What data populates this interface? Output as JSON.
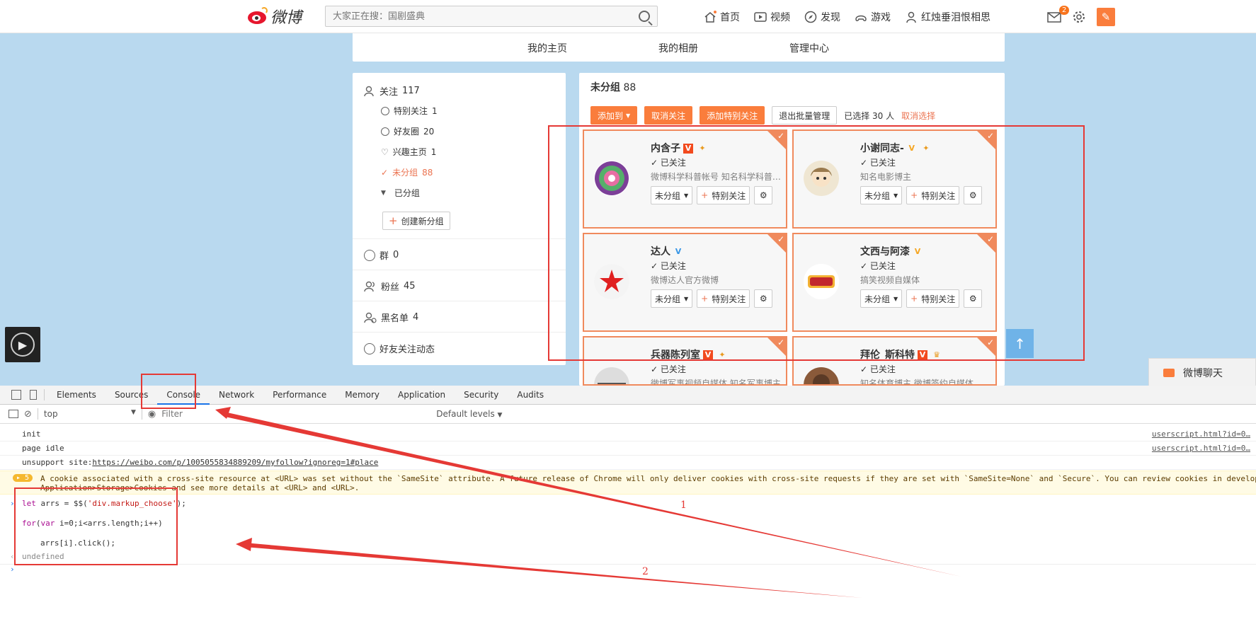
{
  "topbar": {
    "logo_text": "微博",
    "search_placeholder": "大家正在搜：国剧盛典",
    "nav": [
      "首页",
      "视频",
      "发现",
      "游戏",
      "红烛垂泪恨相思"
    ],
    "message_badge": "2"
  },
  "subnav": [
    "我的主页",
    "我的相册",
    "管理中心"
  ],
  "left": {
    "follow": "关注",
    "follow_count": "117",
    "sub": [
      {
        "label": "特别关注",
        "count": "1"
      },
      {
        "label": "好友圈",
        "count": "20"
      },
      {
        "label": "兴趣主页",
        "count": "1"
      },
      {
        "label": "未分组",
        "count": "88"
      },
      {
        "label": "已分组",
        "count": ""
      }
    ],
    "create_group": "创建新分组",
    "groups": {
      "label": "群",
      "count": "0"
    },
    "fans": {
      "label": "粉丝",
      "count": "45"
    },
    "blacklist": {
      "label": "黑名单",
      "count": "4"
    },
    "friend_feed": "好友关注动态"
  },
  "right": {
    "title": "未分组",
    "title_count": "88",
    "actions": {
      "add_to": "添加到",
      "unfollow": "取消关注",
      "add_special": "添加特别关注",
      "exit_batch": "退出批量管理",
      "selected": "已选择 30 人",
      "cancel_select": "取消选择"
    },
    "followed_label": "已关注",
    "group_btn": "未分组",
    "special_btn": "特别关注",
    "cards": [
      {
        "name": "内含子",
        "desc": "微博科学科普帐号 知名科学科普…"
      },
      {
        "name": "小谢同志-",
        "desc": "知名电影博主"
      },
      {
        "name": "达人",
        "desc": "微博达人官方微博"
      },
      {
        "name": "文西与阿漆",
        "desc": "搞笑视频自媒体"
      },
      {
        "name": "兵器陈列室",
        "desc": "微博军事视频自媒体 知名军事博主"
      },
      {
        "name": "拜伦_斯科特",
        "desc": "知名体育博主 微博签约自媒体"
      }
    ]
  },
  "chat": "微博聊天",
  "devtools": {
    "tabs": [
      "Elements",
      "Sources",
      "Console",
      "Network",
      "Performance",
      "Memory",
      "Application",
      "Security",
      "Audits"
    ],
    "context": "top",
    "filter_placeholder": "Filter",
    "levels": "Default levels",
    "log_init": "init",
    "log_idle": "page idle",
    "src1": "userscript.html?id=0…",
    "src2": "userscript.html?id=0…",
    "unsupport_prefix": "unsupport site:",
    "unsupport_url": "https://weibo.com/p/1005055834889209/myfollow?ignoreg=1#place",
    "warn_count": "5",
    "warn_line1": "A cookie associated with a cross-site resource at <URL> was set without the `SameSite` attribute. A future release of Chrome will only deliver cookies with cross-site requests if they are set with `SameSite=None` and `Secure`. You can review cookies in develop",
    "warn_line2": "Application>Storage>Cookies and see more details at <URL> and <URL>.",
    "code1_kw": "let",
    "code1_rest": " arrs = $$(",
    "code1_str": "'div.markup_choose'",
    "code1_end": ");",
    "code2_kw": "for",
    "code2_open": "(",
    "code2_var": "var",
    "code2_rest": " i=0;i<arrs.length;i++)",
    "code3": "arrs[i].click();",
    "result": "undefined"
  },
  "annotations": {
    "label1": "1",
    "label2": "2"
  }
}
